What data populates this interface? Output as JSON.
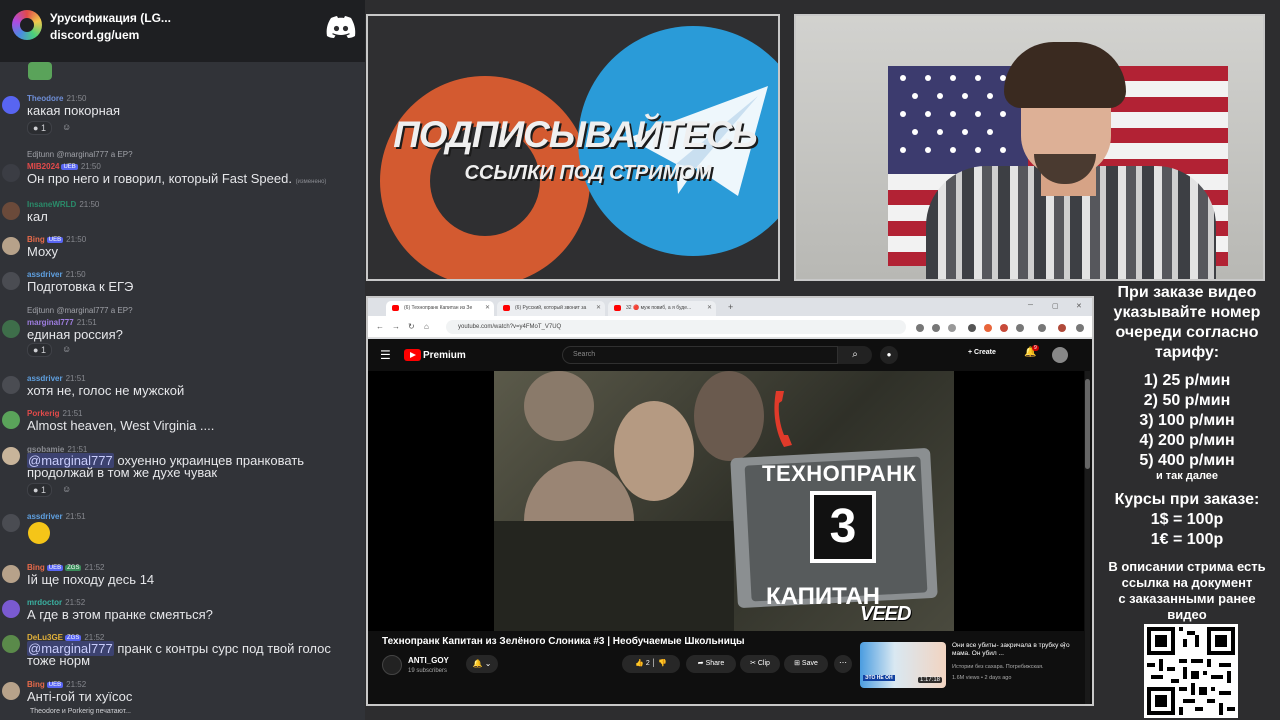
{
  "discord": {
    "server_name": "Урусификация (LG...",
    "invite": "discord.gg/uem",
    "typing": "Theodore и Porkerig печатают...",
    "messages": [
      {
        "user": "Theodore",
        "time": "21:50",
        "text": "какая покорная",
        "react_count": "1",
        "user_color": "#6f8fd8"
      },
      {
        "reply": "Edjtunn @marginal777 а ЕР?",
        "user": "MIB2024",
        "badge": "UEB",
        "time": "21:50",
        "text": "Он про него и говорил, который Fast Speed.",
        "edited": "(изменено)",
        "user_color": "#e24a4a"
      },
      {
        "user": "InsaneWRLD",
        "time": "21:50",
        "text": "кал",
        "user_color": "#2a8c6a"
      },
      {
        "user": "Bing",
        "badge": "UEB",
        "time": "21:50",
        "text": "Моху",
        "user_color": "#e86a4a"
      },
      {
        "user": "assdriver",
        "time": "21:50",
        "text": "Подготовка к ЕГЭ",
        "user_color": "#5fa0e0"
      },
      {
        "reply": "Edjtunn @marginal777 а ЕР?",
        "user": "marginal777",
        "time": "21:51",
        "text": "единая россия?",
        "react_count": "1",
        "user_color": "#9e7de0"
      },
      {
        "user": "assdriver",
        "time": "21:51",
        "text": "хотя не, голос не мужской",
        "user_color": "#5fa0e0"
      },
      {
        "user": "Porkerig",
        "time": "21:51",
        "text": "Almost heaven, West Virginia ....",
        "user_color": "#e24a4a"
      },
      {
        "user": "gsobamie",
        "time": "21:51",
        "mention": "@marginal777",
        "text": " охуенно украинцев пранковать продолжай в том же духе чувак",
        "react_count": "1",
        "user_color": "#8a8c92"
      },
      {
        "user": "assdriver",
        "time": "21:51",
        "text": "",
        "user_color": "#5fa0e0"
      },
      {
        "user": "Bing",
        "badge": "UEB",
        "badge2": "ZGS",
        "time": "21:52",
        "text": "Ій ще походу десь 14",
        "user_color": "#e86a4a"
      },
      {
        "user": "mrdoctor",
        "time": "21:52",
        "text": "А где в этом пранке смеяться?",
        "user_color": "#3ab0a0"
      },
      {
        "user": "DeLu3GE",
        "badge": "ZGS",
        "time": "21:52",
        "mention": "@marginal777",
        "text": " пранк с контры сурс под твой голос тоже норм",
        "user_color": "#e0b03a"
      },
      {
        "user": "Bing",
        "badge": "UEB",
        "time": "21:52",
        "text": "Анті-гой ти хуїсос",
        "user_color": "#e86a4a"
      }
    ]
  },
  "promo": {
    "title": "ПОДПИСЫВАЙТЕСЬ",
    "subtitle": "ССЫЛКИ ПОД СТРИМОМ"
  },
  "browser": {
    "tabs": [
      {
        "label": "(6) Технопранк Капитан из Зе"
      },
      {
        "label": "(6) Русский, который звонит за"
      },
      {
        "label": "32 🔴 муж повиб, а я буде..."
      }
    ],
    "url": "youtube.com/watch?v=y4FMoT_V7UQ",
    "youtube": {
      "brand": "Premium",
      "search_placeholder": "Search",
      "create_label": "Create",
      "notif_count": "9",
      "video_overlay": {
        "title": "ТЕХНОПРАНК",
        "number": "3",
        "caption": "КАПИТАН",
        "watermark": "VEED"
      },
      "video_title": "Технопранк Капитан из Зелёного Слоника #3 | Необучаемые Школьницы",
      "channel_name": "ANTI_GOY",
      "subscribers": "19 subscribers",
      "likes": "2",
      "share_label": "Share",
      "clip_label": "Clip",
      "save_label": "Save",
      "recommended": {
        "title": "Они все убиты- закричала в трубку его мама. Он убил ...",
        "channel": "Истории без сахара. Погребижская.",
        "meta": "1.6M views • 2 days ago",
        "duration": "1:17:18",
        "thumb_tag": "ЭТО НЕ ОН"
      }
    }
  },
  "info": {
    "lines": [
      "При заказе видео",
      "указывайте номер",
      "очереди согласно",
      "тарифу:",
      "1) 25 р/мин",
      "2) 50 р/мин",
      "3) 100 р/мин",
      "4) 200 р/мин",
      "5) 400 р/мин",
      "и так далее",
      "Курсы при заказе:",
      "1$ = 100р",
      "1€ = 100р",
      "В описании стрима есть",
      "ссылка на документ",
      "с заказанными ранее",
      "видео"
    ]
  }
}
